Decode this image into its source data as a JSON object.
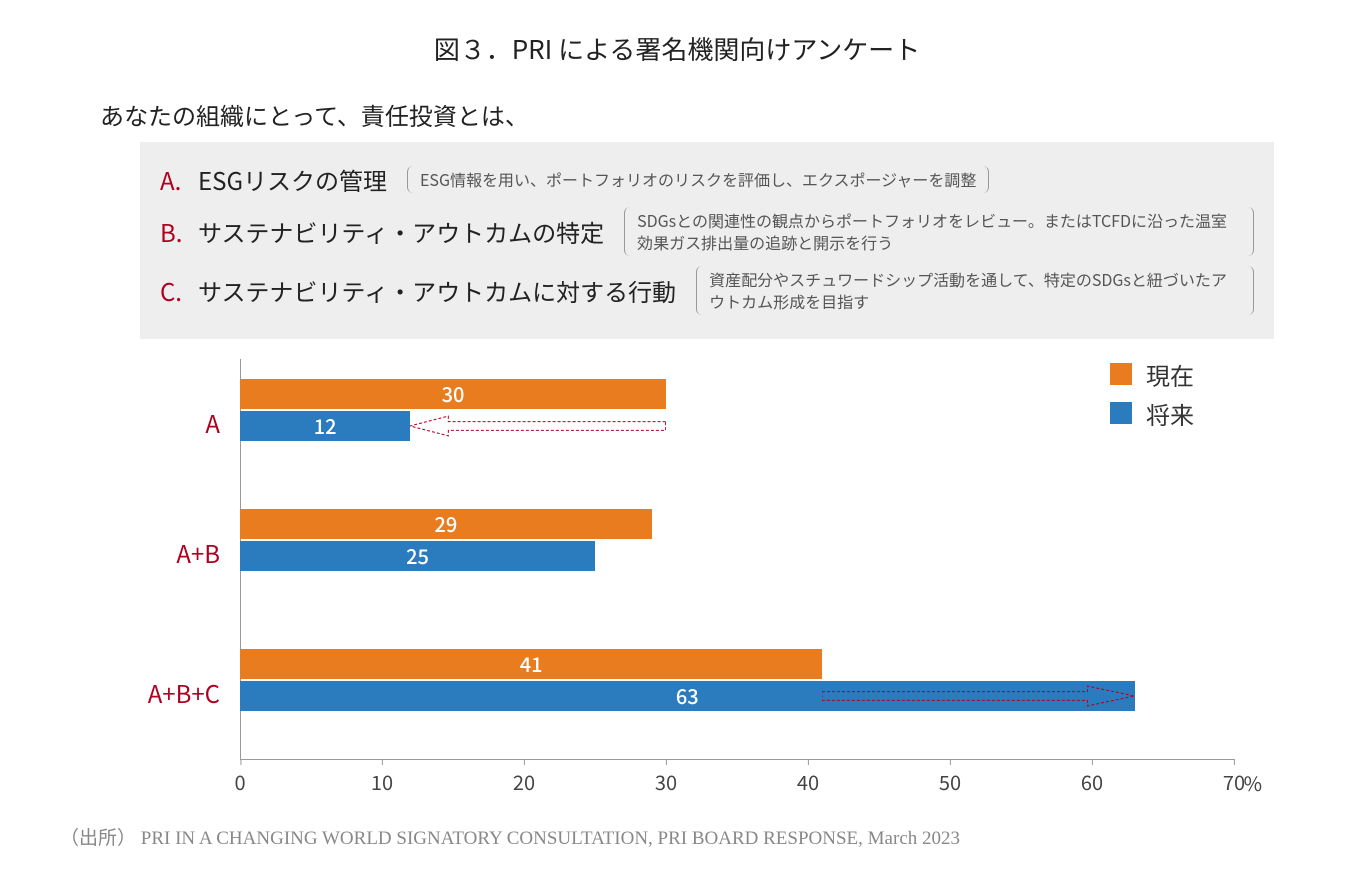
{
  "title": "図３．PRI による署名機関向けアンケート",
  "question": "あなたの組織にとって、責任投資とは、",
  "definitions": {
    "A": {
      "letter": "A.",
      "label": "ESGリスクの管理",
      "desc": "ESG情報を用い、ポートフォリオのリスクを評価し、エクスポージャーを調整"
    },
    "B": {
      "letter": "B.",
      "label": "サステナビリティ・アウトカムの特定",
      "desc": "SDGsとの関連性の観点からポートフォリオをレビュー。またはTCFDに沿った温室効果ガス排出量の追跡と開示を行う"
    },
    "C": {
      "letter": "C.",
      "label": "サステナビリティ・アウトカムに対する行動",
      "desc": "資産配分やスチュワードシップ活動を通して、特定のSDGsと紐づいたアウトカム形成を目指す"
    }
  },
  "legend": {
    "current": "現在",
    "future": "将来"
  },
  "axis": {
    "unit": "%",
    "ticks": [
      "0",
      "10",
      "20",
      "30",
      "40",
      "50",
      "60",
      "70"
    ]
  },
  "source": {
    "prefix": "（出所）",
    "text": "PRI IN A CHANGING WORLD SIGNATORY CONSULTATION, PRI BOARD RESPONSE, March 2023"
  },
  "colors": {
    "current": "#e97c1f",
    "future": "#2b7bbf",
    "accent_red": "#b00020",
    "arrow": "#b00020"
  },
  "chart_data": {
    "type": "bar",
    "orientation": "horizontal",
    "categories": [
      "A",
      "A+B",
      "A+B+C"
    ],
    "series": [
      {
        "name": "現在",
        "values": [
          30,
          29,
          41
        ]
      },
      {
        "name": "将来",
        "values": [
          12,
          25,
          63
        ]
      }
    ],
    "xlabel": "%",
    "ylabel": "",
    "xlim": [
      0,
      70
    ],
    "annotations": [
      {
        "group": "A",
        "direction": "left",
        "from": 30,
        "to": 12
      },
      {
        "group": "A+B+C",
        "direction": "right",
        "from": 41,
        "to": 63
      }
    ]
  }
}
